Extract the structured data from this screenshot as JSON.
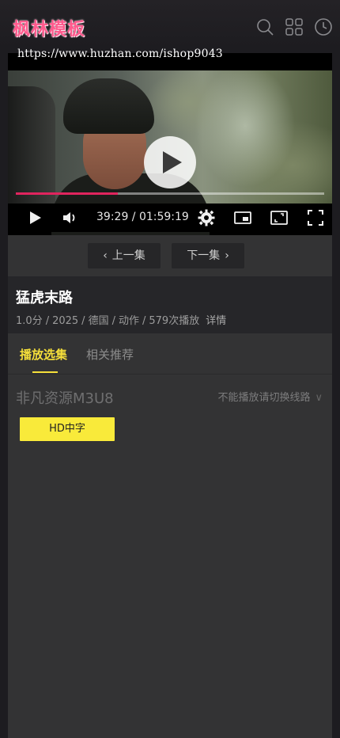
{
  "header": {
    "logo_text": "枫林模板",
    "url_overlay": "https://www.huzhan.com/ishop9043",
    "icons": [
      "search-icon",
      "grid-icon",
      "history-icon"
    ]
  },
  "player": {
    "current_time": "39:29",
    "duration": "01:59:19",
    "time_display": "39:29 / 01:59:19",
    "progress_fraction": 0.33,
    "accent_color": "#e0245e",
    "controls": [
      "play-icon",
      "volume-icon",
      "settings-icon",
      "picture-in-picture-icon",
      "window-expand-icon",
      "fullscreen-icon"
    ]
  },
  "episode_nav": {
    "prev_label": "上一集",
    "next_label": "下一集"
  },
  "info": {
    "title": "猛虎末路",
    "score": "1.0分",
    "year": "2025",
    "region": "德国",
    "genre": "动作",
    "plays": "579次播放",
    "detail_label": "详情"
  },
  "panel": {
    "tabs": [
      {
        "label": "播放选集",
        "active": true
      },
      {
        "label": "相关推荐",
        "active": false
      }
    ],
    "source_name": "非凡资源M3U8",
    "switch_hint": "不能播放请切换线路",
    "episodes": [
      {
        "label": "HD中字",
        "selected": true
      }
    ],
    "accent_color": "#f5df3a"
  }
}
